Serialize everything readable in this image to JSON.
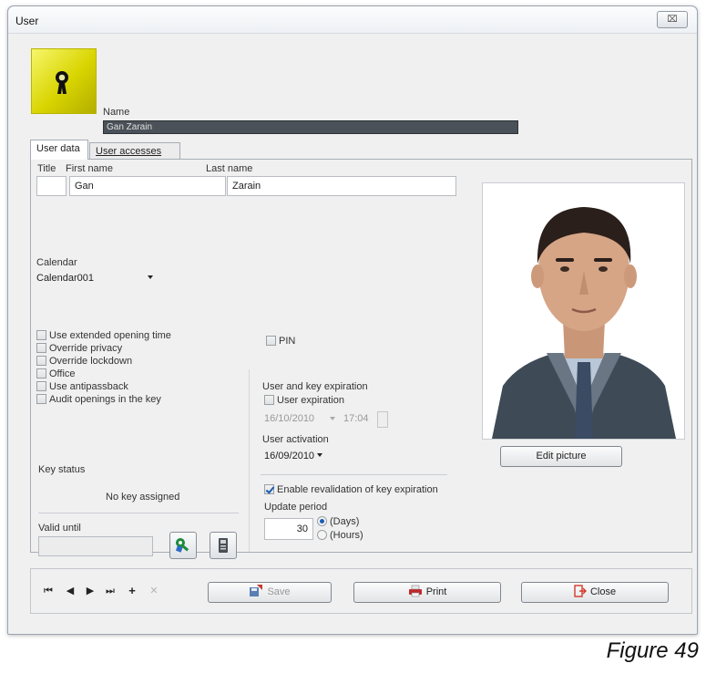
{
  "window": {
    "title": "User",
    "close_glyph": "⌧"
  },
  "header": {
    "logo_icon": "user-key-icon",
    "name_label": "Name",
    "name_value": "Gan Zarain"
  },
  "tabs": [
    {
      "label": "User data",
      "active": true
    },
    {
      "label": "User accesses",
      "active": false
    }
  ],
  "user_data": {
    "title_label": "Title",
    "title_value": "",
    "first_name_label": "First name",
    "first_name_value": "Gan",
    "last_name_label": "Last name",
    "last_name_value": "Zarain",
    "calendar_label": "Calendar",
    "calendar_value": "Calendar001",
    "checkboxes": [
      {
        "label": "Use extended opening time",
        "checked": false
      },
      {
        "label": "Override privacy",
        "checked": false
      },
      {
        "label": "Override lockdown",
        "checked": false
      },
      {
        "label": "Office",
        "checked": false
      },
      {
        "label": "Use antipassback",
        "checked": false
      },
      {
        "label": "Audit openings in the key",
        "checked": false
      }
    ],
    "pin_label": "PIN",
    "pin_checked": false,
    "expiration_group_label": "User and key expiration",
    "user_expiration_label": "User expiration",
    "user_expiration_checked": false,
    "expiration_date": "16/10/2010",
    "expiration_time": "17:04",
    "user_activation_label": "User activation",
    "activation_date": "16/09/2010",
    "revalidation_label": "Enable revalidation of key expiration",
    "revalidation_checked": true,
    "update_period_label": "Update period",
    "update_period_value": "30",
    "period_options": [
      {
        "label": "(Days)",
        "selected": true
      },
      {
        "label": "(Hours)",
        "selected": false
      }
    ],
    "key_status_label": "Key status",
    "key_status_value": "No key assigned",
    "valid_until_label": "Valid until",
    "valid_until_value": "",
    "edit_picture_label": "Edit picture"
  },
  "toolbar": {
    "save_label": "Save",
    "print_label": "Print",
    "close_label": "Close"
  },
  "caption": "Figure 49",
  "colors": {
    "logo_yellow": "#d8d400",
    "name_field_bg": "#4a5158",
    "check_blue": "#1b5db5",
    "print_icon": "#c0282a",
    "close_icon": "#d23a2a"
  }
}
